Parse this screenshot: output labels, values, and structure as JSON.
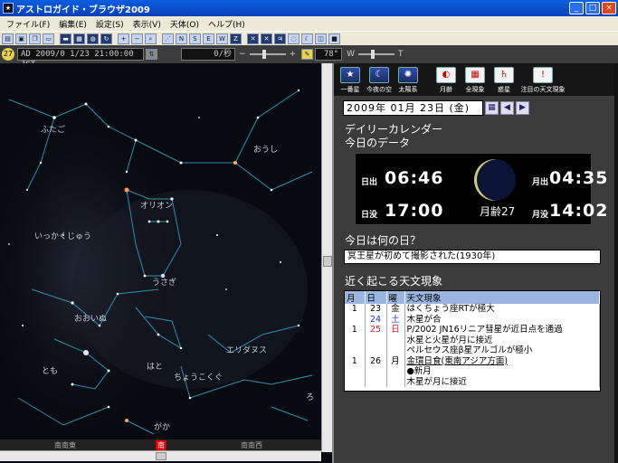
{
  "window": {
    "title": "アストロガイド・ブラウザ2009",
    "icon": "app-icon"
  },
  "menu": [
    "ファイル(F)",
    "編集(E)",
    "設定(S)",
    "表示(V)",
    "天体(O)",
    "ヘルプ(H)"
  ],
  "toolbar2": {
    "dial": "27",
    "datetime": "AD 2009/0 1/23 21:00:00 JST",
    "speed": "0/秒",
    "fov": "78°",
    "slider_w": "W",
    "slider_t": "T"
  },
  "sky": {
    "labels": [
      "ふたご",
      "おうし",
      "オリオン",
      "いっかくじゅう",
      "うさぎ",
      "おおいぬ",
      "エリダヌス",
      "はと",
      "とも",
      "ちょうこくぐ",
      "がか",
      "ろ"
    ],
    "directions": {
      "left": "南南東",
      "center": "南",
      "right": "南南西"
    }
  },
  "right_tools": [
    {
      "label": "一番星",
      "icon": "star-icon"
    },
    {
      "label": "今夜の空",
      "icon": "night-sky-icon"
    },
    {
      "label": "太陽系",
      "icon": "solar-system-icon"
    },
    {
      "label": "月齢",
      "icon": "moon-calendar-icon"
    },
    {
      "label": "全現象",
      "icon": "all-events-icon"
    },
    {
      "label": "惑星",
      "icon": "planet-icon"
    },
    {
      "label": "注目の天文現象",
      "icon": "notable-events-icon"
    }
  ],
  "calendar": {
    "date": "2009年 01月 23日 (金)",
    "heading1": "デイリーカレンダー",
    "heading2": "今日のデータ",
    "sunrise_label": "日出",
    "sunrise": "06:46",
    "sunset_label": "日没",
    "sunset": "17:00",
    "moonrise_label": "月出",
    "moonrise": "04:35",
    "moonset_label": "月没",
    "moonset": "14:02",
    "moon_age": "月齢27",
    "whatday_heading": "今日は何の日？",
    "whatday_text": "冥王星が初めて撮影された(1930年)",
    "events_heading": "近く起こる天文現象",
    "columns": [
      "月",
      "日",
      "曜",
      "天文現象"
    ],
    "rows": [
      {
        "m": "1",
        "d": "23",
        "w": "金",
        "e": "はくちょう座RTが極大",
        "cls": ""
      },
      {
        "m": "",
        "d": "24",
        "w": "土",
        "e": "木星が合",
        "cls": "blue"
      },
      {
        "m": "1",
        "d": "25",
        "w": "日",
        "e": "P/2002 JN16リニア彗星が近日点を通過",
        "cls": "red"
      },
      {
        "m": "",
        "d": "",
        "w": "",
        "e": "水星と火星が月に接近",
        "cls": ""
      },
      {
        "m": "",
        "d": "",
        "w": "",
        "e": "ペルセウス座β星アルゴルが極小",
        "cls": ""
      },
      {
        "m": "1",
        "d": "26",
        "w": "月",
        "e": "金環日食(東南アジア方面)",
        "cls": "link"
      },
      {
        "m": "",
        "d": "",
        "w": "",
        "e": "●新月",
        "cls": ""
      },
      {
        "m": "",
        "d": "",
        "w": "",
        "e": "木星が月に接近",
        "cls": ""
      }
    ]
  }
}
